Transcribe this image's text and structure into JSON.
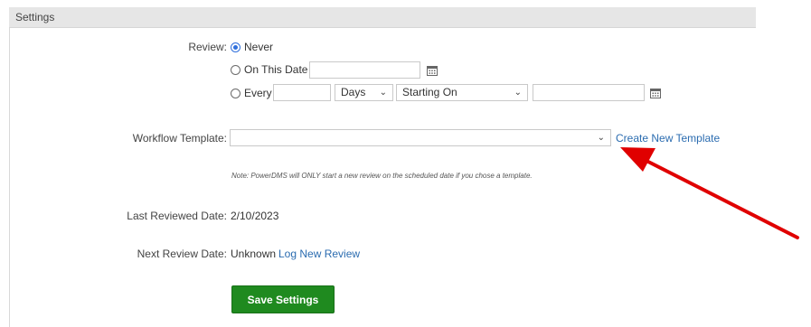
{
  "header": {
    "title": "Settings"
  },
  "review": {
    "label": "Review:",
    "options": {
      "never": "Never",
      "on_this_date": "On This Date",
      "every": "Every"
    },
    "selected": "never",
    "every_unit": "Days",
    "every_start": "Starting On"
  },
  "workflow": {
    "label": "Workflow Template:",
    "selected": "",
    "create_link": "Create New Template",
    "note": "Note: PowerDMS will ONLY start a new review on the scheduled date if you chose a template."
  },
  "last_reviewed": {
    "label": "Last Reviewed Date:",
    "value": "2/10/2023"
  },
  "next_review": {
    "label": "Next Review Date:",
    "value": "Unknown",
    "link": "Log New Review"
  },
  "save_button": {
    "label": "Save Settings"
  },
  "colors": {
    "header_bg": "#e6e6e6",
    "link": "#2b6cb0",
    "save_button": "#1f8a1f",
    "annotation_arrow": "#e00000",
    "radio_selected": "#2f6fdc"
  },
  "icons": {
    "calendar": "calendar-icon",
    "dropdown": "chevron-down-icon"
  }
}
